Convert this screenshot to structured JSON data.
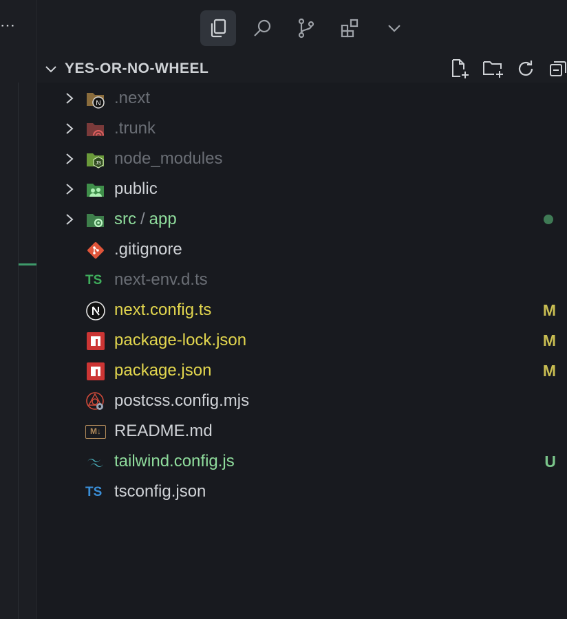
{
  "leftstrip": {
    "overflow_glyph": "⋯"
  },
  "toolbar": {
    "buttons": [
      {
        "icon": "files-icon",
        "active": true
      },
      {
        "icon": "search-icon",
        "active": false
      },
      {
        "icon": "source-control-icon",
        "active": false
      },
      {
        "icon": "extensions-icon",
        "active": false
      },
      {
        "icon": "chevron-down-icon",
        "active": false
      }
    ]
  },
  "explorer": {
    "title": "YES-OR-NO-WHEEL",
    "actions": [
      "new-file-icon",
      "new-folder-icon",
      "refresh-icon",
      "collapse-all-icon"
    ]
  },
  "tree": [
    {
      "name": ".next",
      "type": "folder",
      "icon": "next-folder-icon",
      "status": "dim"
    },
    {
      "name": ".trunk",
      "type": "folder",
      "icon": "trunk-folder-icon",
      "status": "dim"
    },
    {
      "name": "node_modules",
      "type": "folder",
      "icon": "node-folder-icon",
      "status": "dim"
    },
    {
      "name": "public",
      "type": "folder",
      "icon": "public-folder-icon",
      "status": "normal"
    },
    {
      "name_parts": [
        "src",
        "/",
        "app"
      ],
      "type": "folder",
      "icon": "src-folder-icon",
      "status": "green",
      "dot": true
    },
    {
      "name": ".gitignore",
      "type": "file",
      "icon": "git-icon",
      "status": "normal"
    },
    {
      "name": "next-env.d.ts",
      "type": "file",
      "icon": "typescript-icon",
      "icon_text": "TS",
      "status": "dim"
    },
    {
      "name": "next.config.ts",
      "type": "file",
      "icon": "nextjs-icon",
      "status": "yellow",
      "badge": "M"
    },
    {
      "name": "package-lock.json",
      "type": "file",
      "icon": "npm-icon",
      "status": "yellow",
      "badge": "M"
    },
    {
      "name": "package.json",
      "type": "file",
      "icon": "npm-icon",
      "status": "yellow",
      "badge": "M"
    },
    {
      "name": "postcss.config.mjs",
      "type": "file",
      "icon": "postcss-icon",
      "status": "normal"
    },
    {
      "name": "README.md",
      "type": "file",
      "icon": "markdown-icon",
      "icon_text": "M↓",
      "status": "normal"
    },
    {
      "name": "tailwind.config.js",
      "type": "file",
      "icon": "tailwind-icon",
      "status": "green",
      "badge": "U"
    },
    {
      "name": "tsconfig.json",
      "type": "file",
      "icon": "tsconfig-icon",
      "icon_text": "TS",
      "status": "normal"
    }
  ],
  "colors": {
    "dim": "#6a6e75",
    "normal": "#cfd2d6",
    "green": "#8fdc9c",
    "yellow": "#e2d64e"
  }
}
